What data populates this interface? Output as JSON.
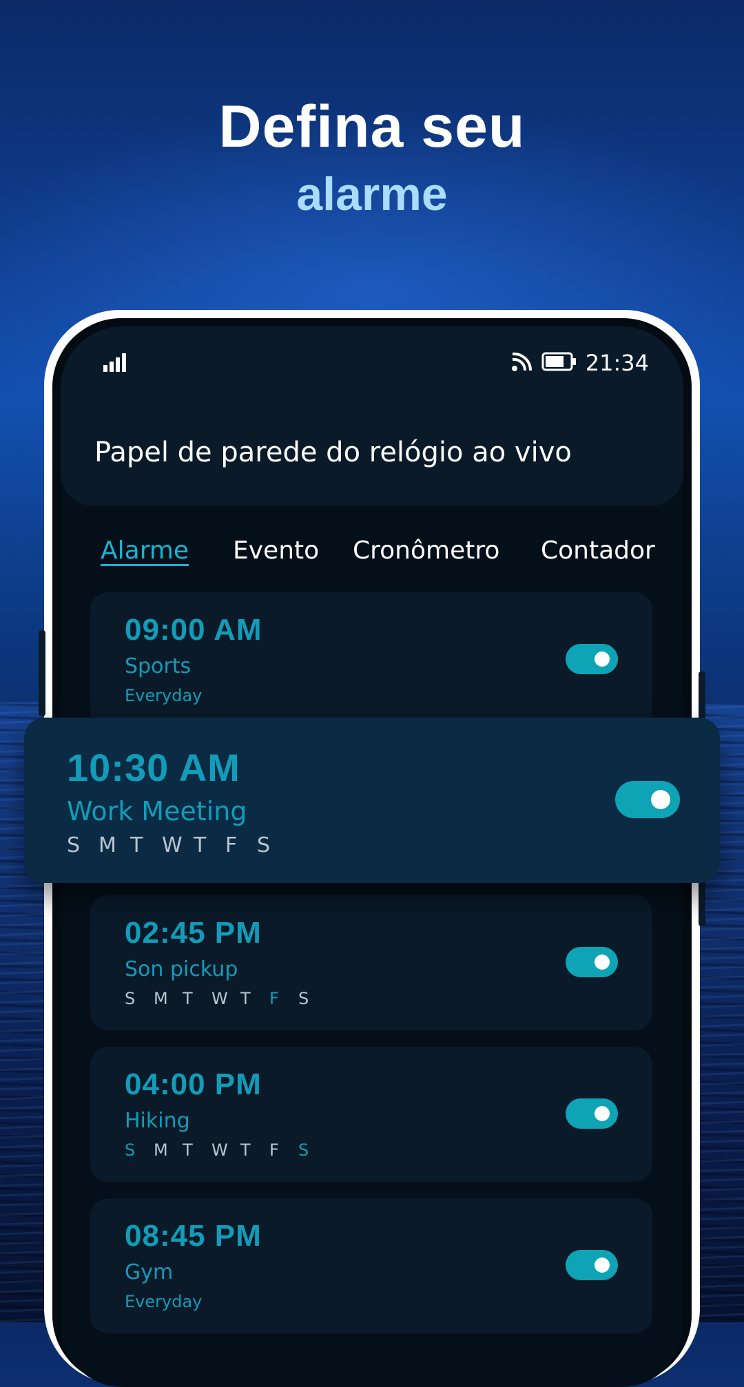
{
  "headline": {
    "line1": "Defina seu",
    "line2": "alarme"
  },
  "status_bar": {
    "time": "21:34",
    "signal_icon": "signal-bars-icon",
    "cast_icon": "cast-icon",
    "battery_icon": "battery-icon"
  },
  "app": {
    "title": "Papel de parede do relógio ao vivo"
  },
  "tabs": [
    {
      "label": "Alarme",
      "active": true
    },
    {
      "label": "Evento",
      "active": false
    },
    {
      "label": "Cronômetro",
      "active": false
    },
    {
      "label": "Contador",
      "active": false
    }
  ],
  "alarms": [
    {
      "time": "09:00 AM",
      "label": "Sports",
      "repeat": "Everyday",
      "enabled": true
    },
    {
      "time": "10:30 AM",
      "label": "Work Meeting",
      "days": [
        "S",
        "M",
        "T",
        "W",
        "T",
        "F",
        "S"
      ],
      "enabled": true
    },
    {
      "time": "02:45 PM",
      "label": "Son pickup",
      "days": [
        "S",
        "M",
        "T",
        "W",
        "T",
        "F",
        "S"
      ],
      "enabled": true
    },
    {
      "time": "04:00 PM",
      "label": "Hiking",
      "days": [
        "S",
        "M",
        "T",
        "W",
        "T",
        "F",
        "S"
      ],
      "enabled": true
    },
    {
      "time": "08:45 PM",
      "label": "Gym",
      "repeat": "Everyday",
      "enabled": true
    }
  ],
  "colors": {
    "accent": "#129cb8",
    "toggle": "#0fa3b6",
    "headline_highlight": "#a9dcff",
    "card": "#0a1a29",
    "popup": "#0b2b45"
  }
}
